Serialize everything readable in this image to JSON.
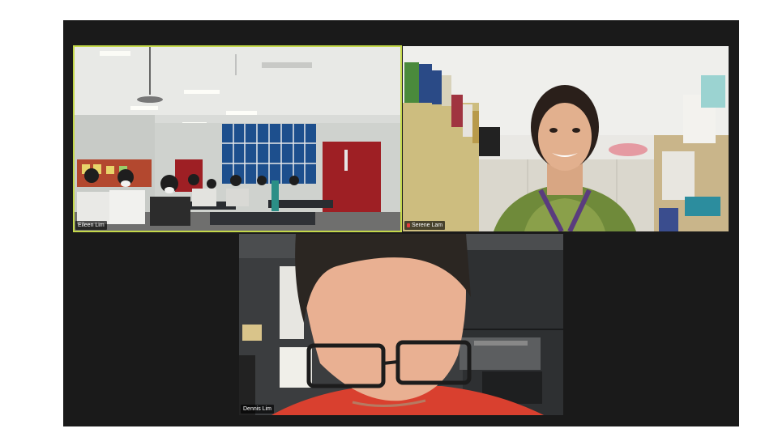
{
  "participants": [
    {
      "name": "Eileen Lim"
    },
    {
      "name": "Serene Lam"
    },
    {
      "name": "Dennis Lim"
    }
  ],
  "colors": {
    "background": "#1a1a1a",
    "active_speaker_border": "#c4d84a",
    "name_tag_bg": "#000000",
    "mic_muted": "#e23b3b"
  }
}
